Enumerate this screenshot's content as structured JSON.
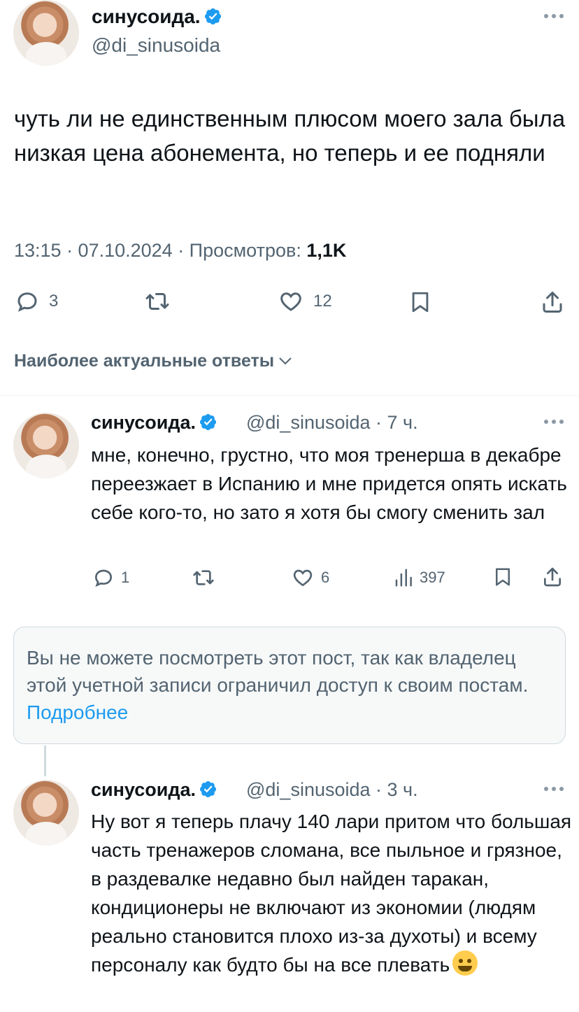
{
  "tweet": {
    "display_name": "синусоида.",
    "handle": "@di_sinusoida",
    "text": "чуть ли не единственным плюсом моего зала была низкая цена абонемента, но теперь и ее подняли",
    "time": "13:15 · 07.10.2024 · Просмотров: ",
    "views": "1,1K",
    "actions": {
      "replies": "3",
      "likes": "12"
    }
  },
  "sort": {
    "label": "Наиболее актуальные ответы"
  },
  "replies": [
    {
      "display_name": "синусоида.",
      "handle_time": "@di_sinusoida · 7 ч.",
      "text": "мне, конечно, грустно, что моя тренерша в декабре переезжает в Испанию и мне придется опять искать себе кого-то, но зато я хотя бы смогу сменить зал",
      "replies": "1",
      "likes": "6",
      "views": "397"
    },
    {
      "display_name": "синусоида.",
      "handle_time": "@di_sinusoida · 3 ч.",
      "text": "Ну вот я теперь плачу 140 лари притом что большая часть тренажеров сломана, все пыльное и грязное, в раздевалке недавно был найден таракан, кондиционеры не включают из экономии (людям реально становится плохо из-за духоты) и всему персоналу как будто бы на все плевать"
    }
  ],
  "restricted": {
    "text": "Вы не можете посмотреть этот пост, так как владелец этой учетной записи ограничил доступ к своим постам. ",
    "link": "Подробнее"
  },
  "icons": {
    "verified": "verified-badge-icon",
    "more": "more-icon",
    "reply": "reply-icon",
    "retweet": "retweet-icon",
    "like": "heart-icon",
    "bookmark": "bookmark-icon",
    "share": "share-icon",
    "views": "views-icon",
    "emoji": "melting-face-emoji"
  },
  "colors": {
    "accent": "#1d9bf0",
    "text": "#0f1419",
    "secondary": "#536471"
  }
}
